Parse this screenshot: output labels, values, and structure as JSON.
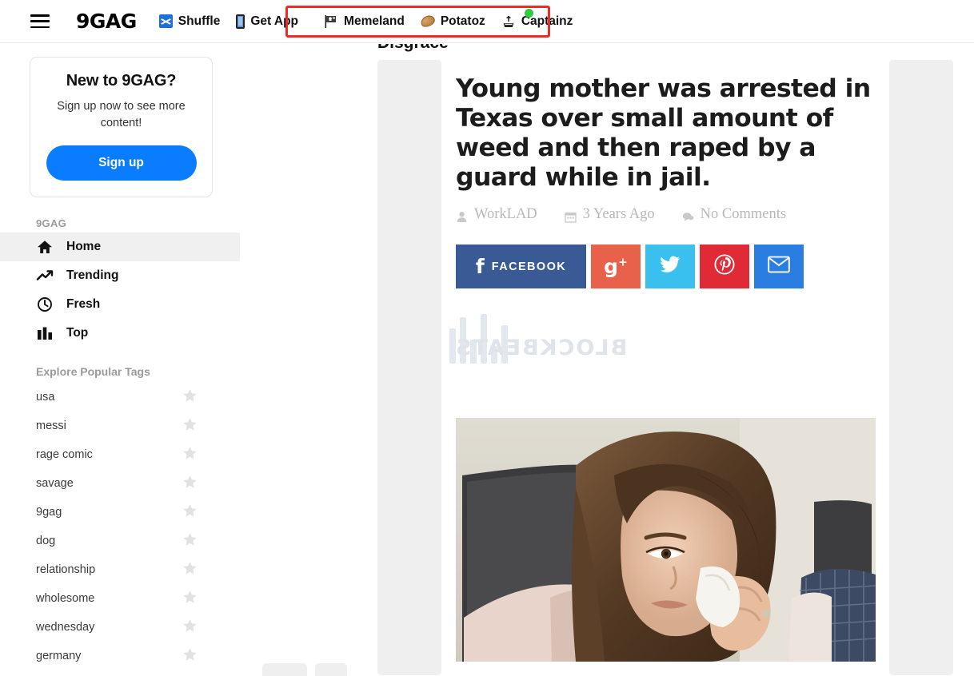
{
  "header": {
    "menu_icon": "hamburger-icon",
    "brand": "9GAG",
    "nav": [
      {
        "label": "Shuffle",
        "icon": "shuffle-icon"
      },
      {
        "label": "Get App",
        "icon": "phone-icon"
      },
      {
        "label": "Memeland",
        "icon": "pirate-flag-icon"
      },
      {
        "label": "Potatoz",
        "icon": "potato-icon"
      },
      {
        "label": "Captainz",
        "icon": "captain-icon",
        "badge": "online-dot"
      }
    ],
    "highlight_color": "#ef2b24",
    "badge_color": "#2ecc40"
  },
  "sidebar": {
    "signup": {
      "title": "New to 9GAG?",
      "subtitle": "Sign up now to see more content!",
      "button_label": "Sign up",
      "button_color": "#0a7cff"
    },
    "section_label": "9GAG",
    "nav_items": [
      {
        "label": "Home",
        "icon": "home-icon",
        "active": true
      },
      {
        "label": "Trending",
        "icon": "trending-icon",
        "active": false
      },
      {
        "label": "Fresh",
        "icon": "clock-icon",
        "active": false
      },
      {
        "label": "Top",
        "icon": "bar-chart-icon",
        "active": false
      }
    ],
    "tags_label": "Explore Popular Tags",
    "tags": [
      {
        "label": "usa",
        "star": "star-icon"
      },
      {
        "label": "messi",
        "star": "star-icon"
      },
      {
        "label": "rage comic",
        "star": "star-icon"
      },
      {
        "label": "savage",
        "star": "star-icon"
      },
      {
        "label": "9gag",
        "star": "star-icon"
      },
      {
        "label": "dog",
        "star": "star-icon"
      },
      {
        "label": "relationship",
        "star": "star-icon"
      },
      {
        "label": "wholesome",
        "star": "star-icon"
      },
      {
        "label": "wednesday",
        "star": "star-icon"
      },
      {
        "label": "germany",
        "star": "star-icon"
      }
    ]
  },
  "post": {
    "title": "Disgrace",
    "headline": "Young mother was arrested in Texas over small amount of weed and then raped by a guard while in jail.",
    "meta": {
      "author": "WorkLAD",
      "author_icon": "person-icon",
      "date": "3 Years Ago",
      "date_icon": "calendar-icon",
      "comments": "No Comments",
      "comments_icon": "comment-icon"
    },
    "watermark": "BLOCKBEATS",
    "share_buttons": [
      {
        "name": "facebook",
        "label": "FACEBOOK",
        "glyph": "f",
        "color": "#3a5a96"
      },
      {
        "name": "googleplus",
        "label": "",
        "glyph": "g+",
        "color": "#e8614a"
      },
      {
        "name": "twitter",
        "label": "",
        "glyph": "twitter-bird-icon",
        "color": "#39c0ef"
      },
      {
        "name": "pinterest",
        "label": "",
        "glyph": "pinterest-icon",
        "color": "#e02b36"
      },
      {
        "name": "email",
        "label": "",
        "glyph": "envelope-icon",
        "color": "#2a7de1"
      }
    ],
    "photo_alt": "woman-crying-wiping-eyes-photo"
  }
}
